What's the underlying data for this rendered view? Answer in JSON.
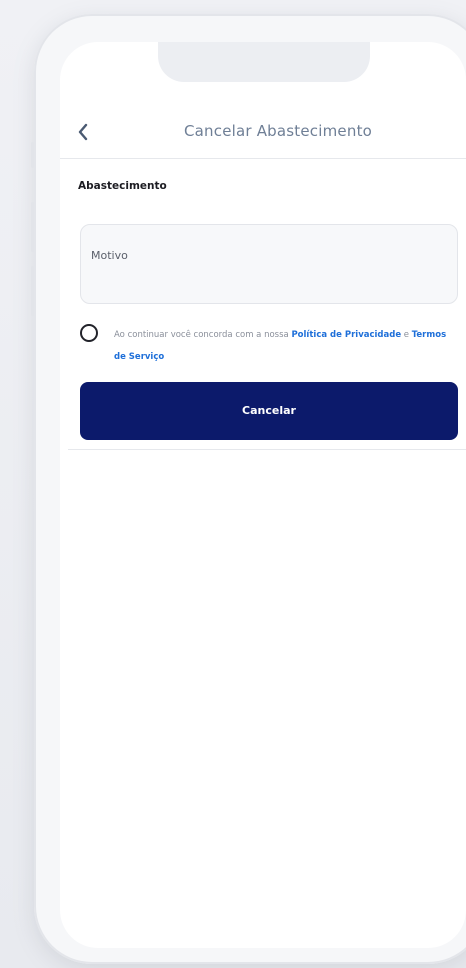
{
  "header": {
    "title": "Cancelar Abastecimento",
    "back_icon": "chevron-left-icon"
  },
  "form": {
    "section_label": "Abastecimento",
    "motivo_placeholder": "Motivo",
    "consent": {
      "prefix": "Ao continuar você concorda com a nossa ",
      "privacy_link": "Política de Privacidade",
      "connector": " e ",
      "terms_link": "Termos de Serviço"
    },
    "cancel_label": "Cancelar"
  },
  "colors": {
    "primary_button": "#0c1a6b",
    "link": "#1e6fd9",
    "header_title": "#6f7f96"
  }
}
